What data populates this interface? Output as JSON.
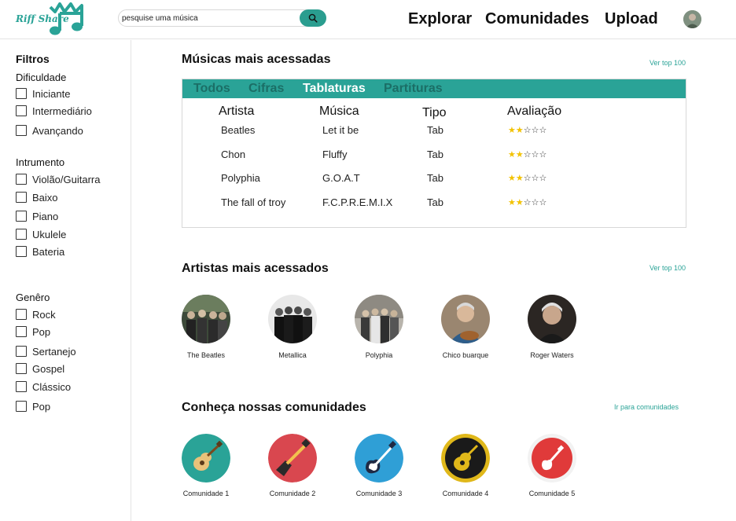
{
  "brand": {
    "name": "Riff Share",
    "accent": "#2aa397"
  },
  "search": {
    "placeholder": "pesquise uma música",
    "value": "pesquise uma música",
    "icon": "search-icon"
  },
  "nav": {
    "explore": "Explorar",
    "communities": "Comunidades",
    "upload": "Upload"
  },
  "sidebar": {
    "title": "Filtros",
    "difficulty": {
      "title": "Dificuldade",
      "options": [
        "Iniciante",
        "Intermediário",
        "Avançando"
      ]
    },
    "instrument": {
      "title": "Intrumento",
      "options": [
        "Violão/Guitarra",
        "Baixo",
        "Piano",
        "Ukulele",
        "Bateria"
      ]
    },
    "genre": {
      "title": "Genêro",
      "options": [
        "Rock",
        "Pop",
        "Sertanejo",
        "Gospel",
        "Clássico",
        "Pop"
      ]
    }
  },
  "top_songs": {
    "title": "Músicas mais acessadas",
    "see_more": "Ver top 100",
    "tabs": [
      "Todos",
      "Cifras",
      "Tablaturas",
      "Partituras"
    ],
    "active_tab": "Tablaturas",
    "columns": [
      "Artista",
      "Música",
      "Tipo",
      "Avaliação"
    ],
    "rows": [
      {
        "artist": "Beatles",
        "song": "Let it be",
        "type": "Tab",
        "rating": 2,
        "max_rating": 5
      },
      {
        "artist": "Chon",
        "song": "Fluffy",
        "type": "Tab",
        "rating": 2,
        "max_rating": 5
      },
      {
        "artist": "Polyphia",
        "song": "G.O.A.T",
        "type": "Tab",
        "rating": 2,
        "max_rating": 5
      },
      {
        "artist": "The fall of troy",
        "song": "F.C.P.R.E.M.I.X",
        "type": "Tab",
        "rating": 2,
        "max_rating": 5
      }
    ]
  },
  "top_artists": {
    "title": "Artistas mais acessados",
    "see_more": "Ver top 100",
    "items": [
      "The Beatles",
      "Metallica",
      "Polyphia",
      "Chico buarque",
      "Roger Waters"
    ]
  },
  "communities": {
    "title": "Conheça nossas comunidades",
    "see_more": "Ir para comunidades",
    "items": [
      {
        "label": "Comunidade 1",
        "icon": "acoustic-guitar-icon",
        "color": "#2aa397"
      },
      {
        "label": "Comunidade 2",
        "icon": "electric-guitar-icon",
        "color": "#d9474f"
      },
      {
        "label": "Comunidade 3",
        "icon": "electric-guitar-icon",
        "color": "#2f9fd6"
      },
      {
        "label": "Comunidade 4",
        "icon": "acoustic-guitar-icon",
        "color": "#e0b81a"
      },
      {
        "label": "Comunidade 5",
        "icon": "electric-guitar-icon",
        "color": "#e03a3a"
      }
    ]
  }
}
